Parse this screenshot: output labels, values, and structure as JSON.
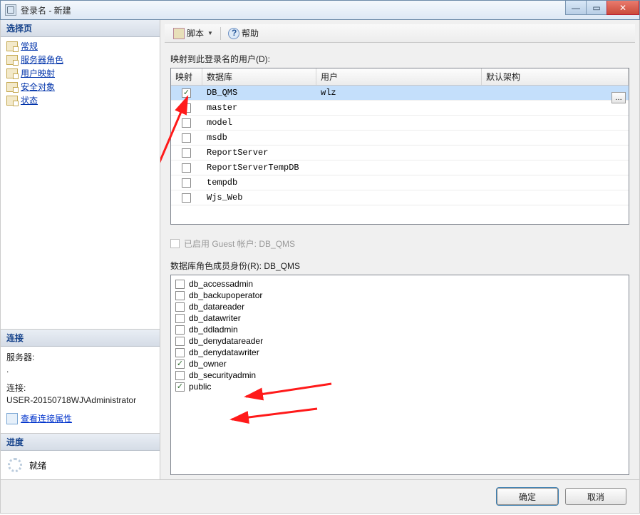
{
  "window": {
    "title": "登录名 - 新建"
  },
  "leftnav": {
    "header": "选择页",
    "items": [
      {
        "label": "常规"
      },
      {
        "label": "服务器角色"
      },
      {
        "label": "用户映射"
      },
      {
        "label": "安全对象"
      },
      {
        "label": "状态"
      }
    ]
  },
  "connection": {
    "header": "连接",
    "server_label": "服务器:",
    "server_value": ".",
    "conn_label": "连接:",
    "conn_value": "USER-20150718WJ\\Administrator",
    "view_props": "查看连接属性"
  },
  "progress": {
    "header": "进度",
    "status": "就绪"
  },
  "toolbar": {
    "script": "脚本",
    "help": "帮助"
  },
  "mapping": {
    "label": "映射到此登录名的用户(D):",
    "columns": {
      "map": "映射",
      "db": "数据库",
      "user": "用户",
      "schema": "默认架构"
    },
    "rows": [
      {
        "checked": true,
        "db": "DB_QMS",
        "user": "wlz",
        "selected": true
      },
      {
        "checked": false,
        "db": "master",
        "user": ""
      },
      {
        "checked": false,
        "db": "model",
        "user": ""
      },
      {
        "checked": false,
        "db": "msdb",
        "user": ""
      },
      {
        "checked": false,
        "db": "ReportServer",
        "user": ""
      },
      {
        "checked": false,
        "db": "ReportServerTempDB",
        "user": ""
      },
      {
        "checked": false,
        "db": "tempdb",
        "user": ""
      },
      {
        "checked": false,
        "db": "Wjs_Web",
        "user": ""
      }
    ]
  },
  "guest": {
    "label": "已启用 Guest 帐户: DB_QMS"
  },
  "roles": {
    "label": "数据库角色成员身份(R): DB_QMS",
    "items": [
      {
        "name": "db_accessadmin",
        "checked": false
      },
      {
        "name": "db_backupoperator",
        "checked": false
      },
      {
        "name": "db_datareader",
        "checked": false
      },
      {
        "name": "db_datawriter",
        "checked": false
      },
      {
        "name": "db_ddladmin",
        "checked": false
      },
      {
        "name": "db_denydatareader",
        "checked": false
      },
      {
        "name": "db_denydatawriter",
        "checked": false
      },
      {
        "name": "db_owner",
        "checked": true
      },
      {
        "name": "db_securityadmin",
        "checked": false
      },
      {
        "name": "public",
        "checked": true
      }
    ]
  },
  "footer": {
    "ok": "确定",
    "cancel": "取消"
  }
}
